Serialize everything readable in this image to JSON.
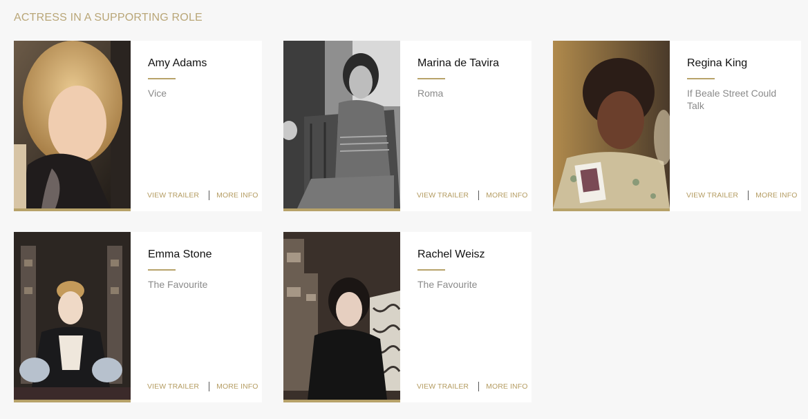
{
  "category": {
    "title": "ACTRESS IN A SUPPORTING ROLE"
  },
  "accent_color": "#b7a269",
  "nominees": [
    {
      "name": "Amy Adams",
      "film": "Vice",
      "view_trailer": "VIEW TRAILER",
      "more_info": "MORE INFO"
    },
    {
      "name": "Marina de Tavira",
      "film": "Roma",
      "view_trailer": "VIEW TRAILER",
      "more_info": "MORE INFO"
    },
    {
      "name": "Regina King",
      "film": "If Beale Street Could Talk",
      "view_trailer": "VIEW TRAILER",
      "more_info": "MORE INFO"
    },
    {
      "name": "Emma Stone",
      "film": "The Favourite",
      "view_trailer": "VIEW TRAILER",
      "more_info": "MORE INFO"
    },
    {
      "name": "Rachel Weisz",
      "film": "The Favourite",
      "view_trailer": "VIEW TRAILER",
      "more_info": "MORE INFO"
    }
  ]
}
